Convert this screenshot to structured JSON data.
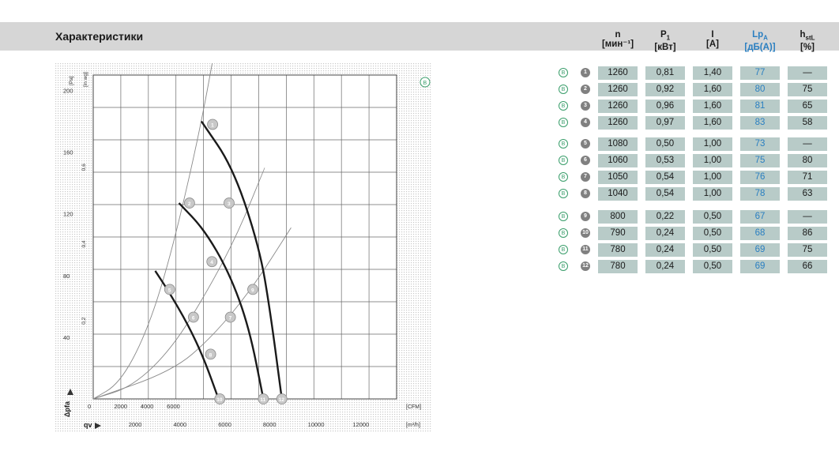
{
  "header": {
    "title": "Характеристики"
  },
  "table": {
    "columns": [
      {
        "sym": "n",
        "sub": "",
        "unit": "[мин⁻¹]"
      },
      {
        "sym": "P",
        "sub": "1",
        "unit": "[кВт]"
      },
      {
        "sym": "I",
        "sub": "",
        "unit": "[A]"
      },
      {
        "sym": "Lp",
        "sub": "A",
        "unit": "[дБ(A)]"
      },
      {
        "sym": "h",
        "sub": "stL",
        "unit": "[%]"
      }
    ],
    "rows": [
      {
        "mark": "B",
        "num": "1",
        "n": "1260",
        "p": "0,81",
        "i": "1,40",
        "lp": "77",
        "h": "—"
      },
      {
        "mark": "B",
        "num": "2",
        "n": "1260",
        "p": "0,92",
        "i": "1,60",
        "lp": "80",
        "h": "75"
      },
      {
        "mark": "B",
        "num": "3",
        "n": "1260",
        "p": "0,96",
        "i": "1,60",
        "lp": "81",
        "h": "65"
      },
      {
        "mark": "B",
        "num": "4",
        "n": "1260",
        "p": "0,97",
        "i": "1,60",
        "lp": "83",
        "h": "58"
      },
      {
        "mark": "B",
        "num": "5",
        "n": "1080",
        "p": "0,50",
        "i": "1,00",
        "lp": "73",
        "h": "—"
      },
      {
        "mark": "B",
        "num": "6",
        "n": "1060",
        "p": "0,53",
        "i": "1,00",
        "lp": "75",
        "h": "80"
      },
      {
        "mark": "B",
        "num": "7",
        "n": "1050",
        "p": "0,54",
        "i": "1,00",
        "lp": "76",
        "h": "71"
      },
      {
        "mark": "B",
        "num": "8",
        "n": "1040",
        "p": "0,54",
        "i": "1,00",
        "lp": "78",
        "h": "63"
      },
      {
        "mark": "B",
        "num": "9",
        "n": "800",
        "p": "0,22",
        "i": "0,50",
        "lp": "67",
        "h": "—"
      },
      {
        "mark": "B",
        "num": "10",
        "n": "790",
        "p": "0,24",
        "i": "0,50",
        "lp": "68",
        "h": "86"
      },
      {
        "mark": "B",
        "num": "11",
        "n": "780",
        "p": "0,24",
        "i": "0,50",
        "lp": "69",
        "h": "75"
      },
      {
        "mark": "B",
        "num": "12",
        "n": "780",
        "p": "0,24",
        "i": "0,50",
        "lp": "69",
        "h": "66"
      }
    ]
  },
  "chart_data": {
    "type": "line",
    "title": "",
    "corner_mark": "B",
    "y_axis": {
      "label": "Δpfa",
      "unit": "[Pa]",
      "unit2": "[in wg]",
      "ticks": [
        {
          "v": 0,
          "label": ""
        },
        {
          "v": 40,
          "label": "40"
        },
        {
          "v": 80,
          "label": "80"
        },
        {
          "v": 120,
          "label": "120"
        },
        {
          "v": 160,
          "label": "160"
        },
        {
          "v": 200,
          "label": "200"
        }
      ],
      "ticks2": [
        {
          "v": 49.8,
          "label": "0,2"
        },
        {
          "v": 99.6,
          "label": "0,4"
        },
        {
          "v": 149.4,
          "label": "0,6"
        }
      ],
      "range": [
        0,
        210
      ]
    },
    "x_axis": {
      "label": "qv",
      "unit": "[m³/h]",
      "ticks": [
        {
          "v": 0,
          "label": "0"
        },
        {
          "v": 2000,
          "label": "2000"
        },
        {
          "v": 4000,
          "label": "4000"
        },
        {
          "v": 6000,
          "label": "6000"
        }
      ],
      "unit2": "[CFM]",
      "ticks2": [
        {
          "v": 3398,
          "label": "2000"
        },
        {
          "v": 6796,
          "label": "4000"
        },
        {
          "v": 10194,
          "label": "6000"
        },
        {
          "v": 13592,
          "label": "8000"
        },
        {
          "v": 16990,
          "label": "10000"
        },
        {
          "v": 20388,
          "label": "12000"
        }
      ],
      "range": [
        0,
        23000
      ]
    },
    "grid": true,
    "series": [
      {
        "name": "",
        "x": [
          8200,
          10600,
          12600,
          13400,
          14300
        ],
        "y": [
          180,
          150,
          98,
          58,
          0
        ]
      },
      {
        "name": "",
        "x": [
          6500,
          8400,
          10300,
          11800,
          12900
        ],
        "y": [
          127,
          110,
          82,
          47,
          0
        ]
      },
      {
        "name": "",
        "x": [
          4700,
          5700,
          7200,
          8400,
          9500
        ],
        "y": [
          83,
          70,
          48,
          26,
          0
        ]
      }
    ],
    "system_curves": [
      {
        "x": [
          0,
          6000,
          9000,
          12000,
          15000
        ],
        "y": [
          0,
          18,
          40,
          71,
          111
        ]
      },
      {
        "x": [
          0,
          3000,
          6000,
          8800,
          11000,
          13000
        ],
        "y": [
          0,
          8,
          33,
          72,
          108,
          150
        ]
      },
      {
        "x": [
          0,
          2000,
          4000,
          5800,
          8000,
          9500
        ],
        "y": [
          0,
          10,
          42,
          90,
          170,
          240
        ]
      }
    ],
    "markers": [
      {
        "label": "1",
        "x": 9050,
        "y": 178
      },
      {
        "label": "2",
        "x": 7300,
        "y": 127
      },
      {
        "label": "3",
        "x": 10300,
        "y": 127
      },
      {
        "label": "4",
        "x": 9000,
        "y": 89
      },
      {
        "label": "5",
        "x": 5800,
        "y": 71
      },
      {
        "label": "6",
        "x": 7600,
        "y": 53
      },
      {
        "label": "7",
        "x": 10400,
        "y": 53
      },
      {
        "label": "8",
        "x": 8900,
        "y": 29
      },
      {
        "label": "9",
        "x": 12100,
        "y": 71
      },
      {
        "label": "10",
        "x": 9600,
        "y": 0
      },
      {
        "label": "11",
        "x": 12900,
        "y": 0
      },
      {
        "label": "12",
        "x": 14300,
        "y": 0
      }
    ]
  },
  "colors": {
    "band": "#d6d6d6",
    "cell": "#b8cbc8",
    "accent": "#2a7fc1",
    "mark": "#3a9e6b",
    "curve": "#1a1a1a"
  }
}
